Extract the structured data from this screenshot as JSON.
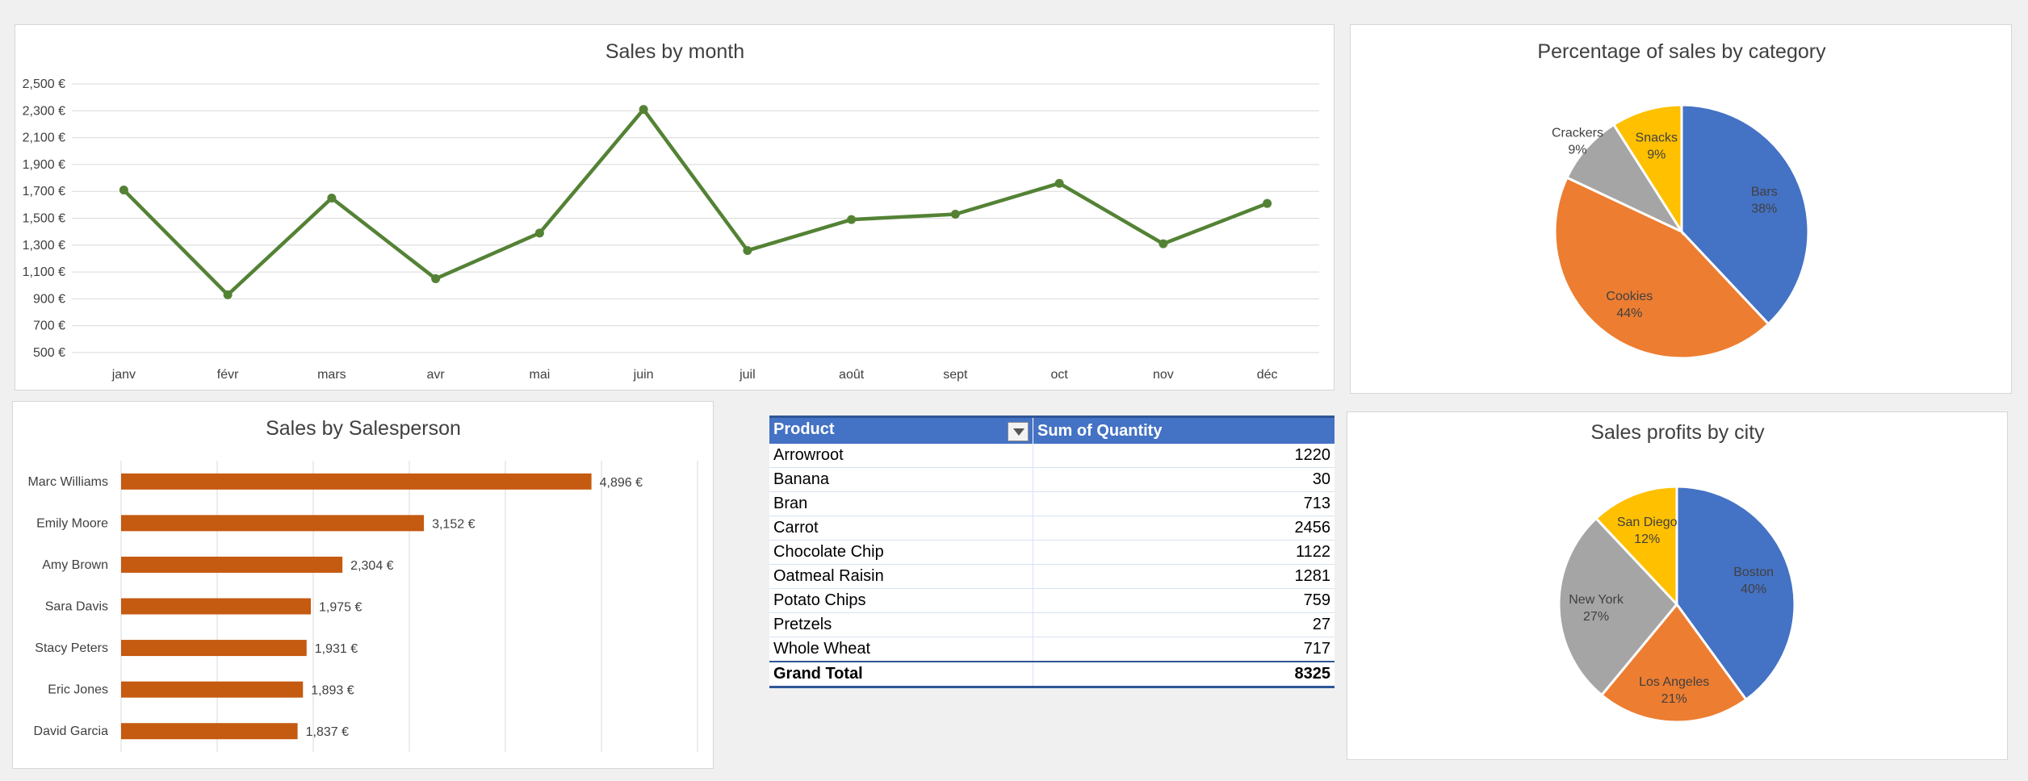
{
  "chart_data": [
    {
      "type": "line",
      "title": "Sales by month",
      "categories": [
        "janv",
        "févr",
        "mars",
        "avr",
        "mai",
        "juin",
        "juil",
        "août",
        "sept",
        "oct",
        "nov",
        "déc"
      ],
      "values": [
        1710,
        930,
        1650,
        1050,
        1390,
        2310,
        1260,
        1490,
        1530,
        1760,
        1310,
        1610
      ],
      "yticks": [
        "2,500 €",
        "2,300 €",
        "2,100 €",
        "1,900 €",
        "1,700 €",
        "1,500 €",
        "1,300 €",
        "1,100 €",
        "900 €",
        "700 €",
        "500 €"
      ],
      "ylim": [
        500,
        2500
      ],
      "color": "#548235",
      "grid": true
    },
    {
      "type": "pie",
      "title": "Percentage of sales by category",
      "labels": [
        "Bars",
        "Cookies",
        "Crackers",
        "Snacks"
      ],
      "values": [
        38,
        44,
        9,
        9
      ],
      "percent_labels": [
        "38%",
        "44%",
        "9%",
        "9%"
      ],
      "colors": [
        "#4472c4",
        "#ed7d31",
        "#a5a5a5",
        "#ffc000"
      ]
    },
    {
      "type": "bar",
      "orientation": "horizontal",
      "title": "Sales by Salesperson",
      "categories": [
        "Marc Williams",
        "Emily Moore",
        "Amy Brown",
        "Sara Davis",
        "Stacy Peters",
        "Eric Jones",
        "David Garcia"
      ],
      "values": [
        4896,
        3152,
        2304,
        1975,
        1931,
        1893,
        1837
      ],
      "value_labels": [
        "4,896 €",
        "3,152 €",
        "2,304 €",
        "1,975 €",
        "1,931 €",
        "1,893 €",
        "1,837 €"
      ],
      "xlim": [
        0,
        6000
      ],
      "color": "#c55a11",
      "grid": true
    },
    {
      "type": "table",
      "columns": [
        "Product",
        "Sum of Quantity"
      ],
      "rows": [
        [
          "Arrowroot",
          "1220"
        ],
        [
          "Banana",
          "30"
        ],
        [
          "Bran",
          "713"
        ],
        [
          "Carrot",
          "2456"
        ],
        [
          "Chocolate Chip",
          "1122"
        ],
        [
          "Oatmeal Raisin",
          "1281"
        ],
        [
          "Potato Chips",
          "759"
        ],
        [
          "Pretzels",
          "27"
        ],
        [
          "Whole Wheat",
          "717"
        ]
      ],
      "total": [
        "Grand Total",
        "8325"
      ],
      "header_color": "#4472c4"
    },
    {
      "type": "pie",
      "title": "Sales profits by city",
      "labels": [
        "Boston",
        "Los Angeles",
        "New York",
        "San Diego"
      ],
      "values": [
        40,
        21,
        27,
        12
      ],
      "percent_labels": [
        "40%",
        "21%",
        "27%",
        "12%"
      ],
      "colors": [
        "#4472c4",
        "#ed7d31",
        "#a5a5a5",
        "#ffc000"
      ]
    }
  ]
}
